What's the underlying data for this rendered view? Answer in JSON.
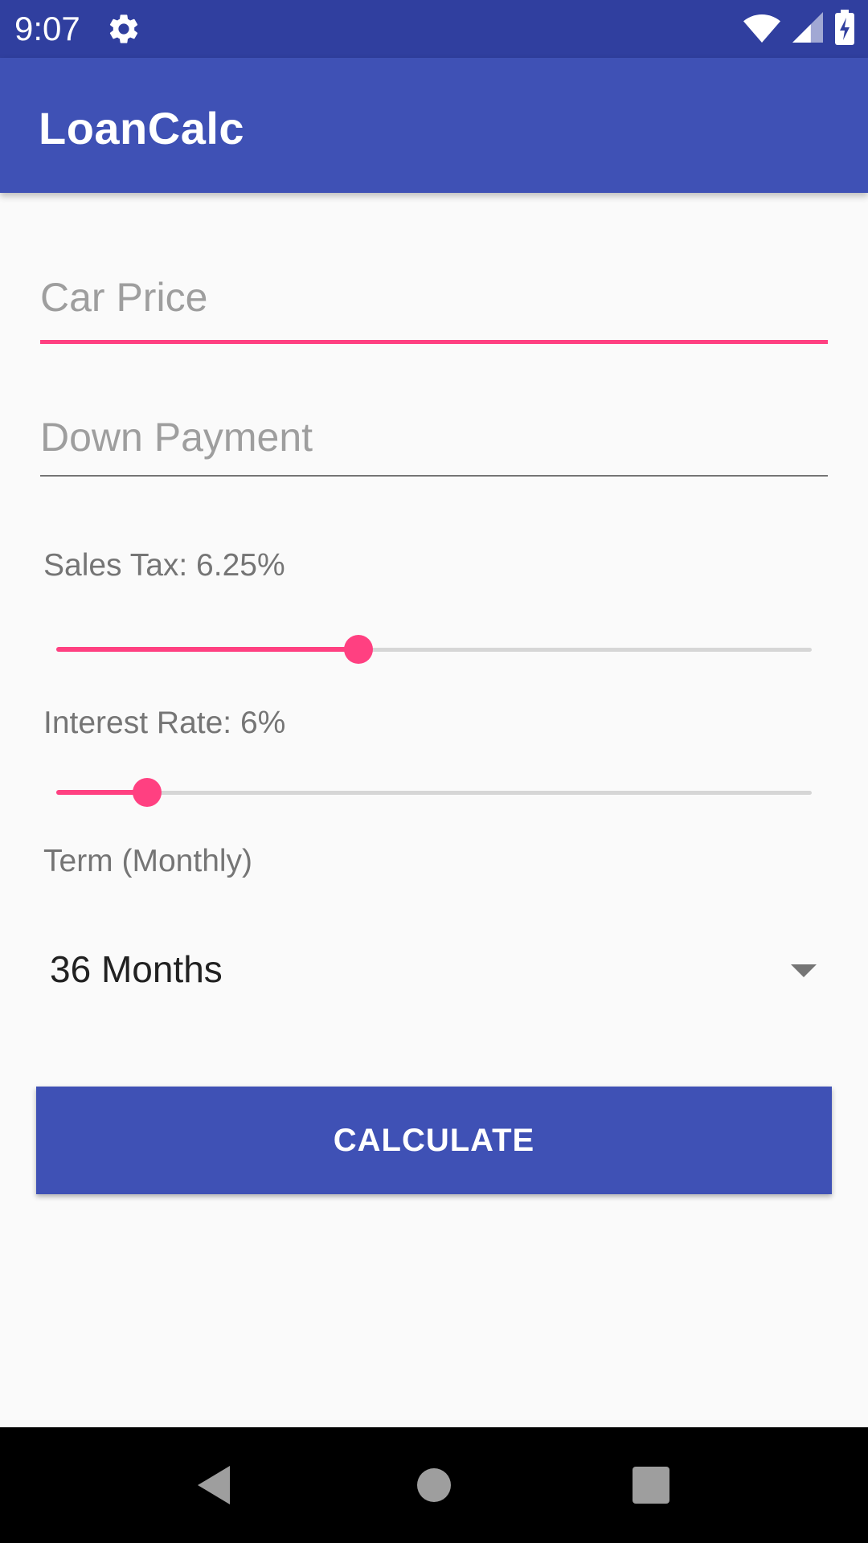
{
  "status_bar": {
    "time": "9:07",
    "icons": [
      "settings-icon",
      "wifi-icon",
      "signal-icon",
      "battery-charging-icon"
    ]
  },
  "app_bar": {
    "title": "LoanCalc"
  },
  "form": {
    "car_price": {
      "value": "",
      "placeholder": "Car Price",
      "focused": true
    },
    "down_payment": {
      "value": "",
      "placeholder": "Down Payment"
    },
    "sales_tax": {
      "label": "Sales Tax: 6.25%",
      "fraction": 0.4
    },
    "interest_rate": {
      "label": "Interest Rate: 6%",
      "fraction": 0.12
    },
    "term": {
      "label": "Term (Monthly)",
      "selected": "36 Months"
    },
    "calculate_label": "CALCULATE"
  },
  "navigation": {
    "icons": [
      "back-icon",
      "home-icon",
      "recents-icon"
    ]
  },
  "colors": {
    "primary": "#3f51b5",
    "primary_dark": "#303f9f",
    "accent": "#ff4081"
  }
}
